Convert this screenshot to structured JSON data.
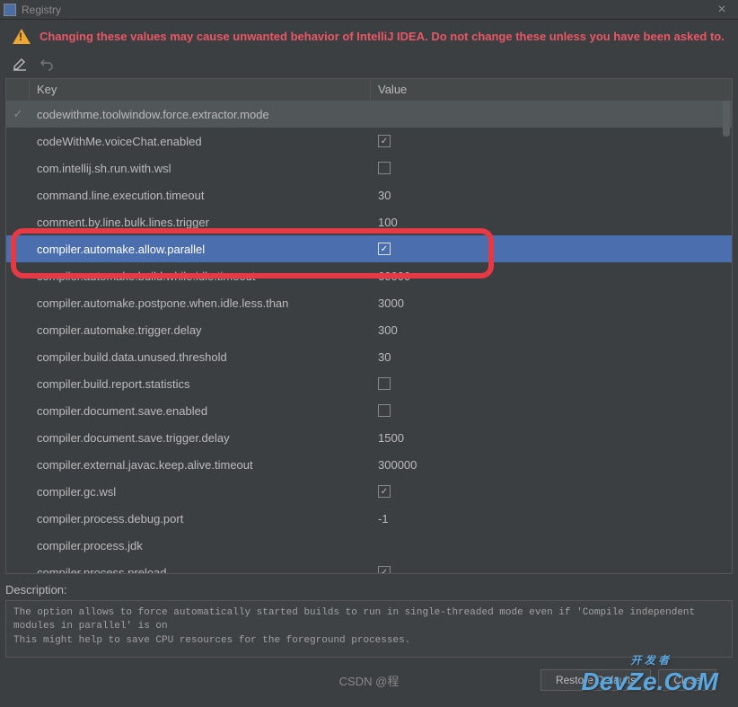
{
  "title": "Registry",
  "warning": "Changing these values may cause unwanted behavior of IntelliJ IDEA. Do not change these unless you have been asked to.",
  "headers": {
    "key": "Key",
    "value": "Value"
  },
  "rows": [
    {
      "edited": true,
      "key": "codewithme.toolwindow.force.extractor.mode",
      "type": "text",
      "value": ""
    },
    {
      "key": "codeWithMe.voiceChat.enabled",
      "type": "bool",
      "value": true
    },
    {
      "key": "com.intellij.sh.run.with.wsl",
      "type": "bool",
      "value": false
    },
    {
      "key": "command.line.execution.timeout",
      "type": "text",
      "value": "30"
    },
    {
      "key": "comment.by.line.bulk.lines.trigger",
      "type": "text",
      "value": "100"
    },
    {
      "selected": true,
      "key": "compiler.automake.allow.parallel",
      "type": "bool",
      "value": true
    },
    {
      "key": "compiler.automake.build.while.idle.timeout",
      "type": "text",
      "value": "60000"
    },
    {
      "key": "compiler.automake.postpone.when.idle.less.than",
      "type": "text",
      "value": "3000"
    },
    {
      "key": "compiler.automake.trigger.delay",
      "type": "text",
      "value": "300"
    },
    {
      "key": "compiler.build.data.unused.threshold",
      "type": "text",
      "value": "30"
    },
    {
      "key": "compiler.build.report.statistics",
      "type": "bool",
      "value": false
    },
    {
      "key": "compiler.document.save.enabled",
      "type": "bool",
      "value": false
    },
    {
      "key": "compiler.document.save.trigger.delay",
      "type": "text",
      "value": "1500"
    },
    {
      "key": "compiler.external.javac.keep.alive.timeout",
      "type": "text",
      "value": "300000"
    },
    {
      "key": "compiler.gc.wsl",
      "type": "bool",
      "value": true
    },
    {
      "key": "compiler.process.debug.port",
      "type": "text",
      "value": "-1"
    },
    {
      "key": "compiler.process.jdk",
      "type": "text",
      "value": ""
    },
    {
      "key": "compiler.process.preload",
      "type": "bool",
      "value": true
    }
  ],
  "description": {
    "label": "Description:",
    "text": "The option allows to force automatically started builds to run in single-threaded mode even if 'Compile independent modules in parallel' is on\nThis might help to save CPU resources for the foreground processes."
  },
  "buttons": {
    "restore": "Restore Defaults",
    "close": "Close"
  },
  "watermarks": {
    "csdn": "CSDN @程",
    "devze_top": "开 发 者",
    "devze": "DevZe.CoM"
  }
}
